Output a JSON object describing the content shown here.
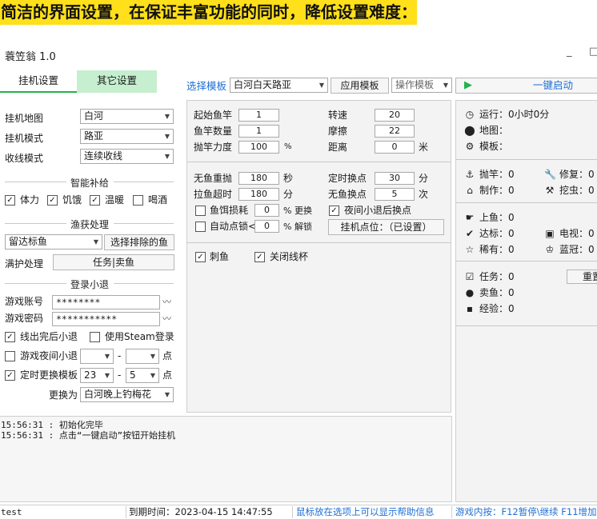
{
  "banner": "简洁的界面设置，在保证丰富功能的同时，降低设置难度：",
  "app": {
    "title": "蓑笠翁 1.0",
    "minimize": "_",
    "maximize": "□"
  },
  "tabs": {
    "t1": "挂机设置",
    "t2": "其它设置"
  },
  "toolbar": {
    "template_label": "选择模板",
    "template_value": "白河白天路亚",
    "apply": "应用模板",
    "ops": "操作模板",
    "play": "▶",
    "start": "一键启动"
  },
  "left": {
    "map_label": "挂机地图",
    "map_value": "白河",
    "mode_label": "挂机模式",
    "mode_value": "路亚",
    "reel_label": "收线模式",
    "reel_value": "连续收线",
    "supply_title": "智能补给",
    "supply": {
      "a": "体力",
      "b": "饥饿",
      "c": "温暖",
      "d": "喝酒"
    },
    "catch_title": "渔获处理",
    "catch_value": "留达标鱼",
    "exclude_btn": "选择排除的鱼",
    "full_label": "满护处理",
    "full_value": "任务|卖鱼",
    "login_title": "登录小退",
    "account_label": "游戏账号",
    "account_value": "********",
    "password_label": "游戏密码",
    "password_value": "***********",
    "logout_after": "线出完后小退",
    "steam_login": "使用Steam登录",
    "night_logout": "游戏夜间小退",
    "dash1": "-",
    "dot1": "点",
    "timed_change": "定时更换模板",
    "hour_from": "23",
    "dash2": "-",
    "hour_to": "5",
    "dot2": "点",
    "change_to_label": "更换为",
    "change_to_value": "白河晚上钓梅花"
  },
  "mid": {
    "start_rod_l": "起始鱼竿",
    "start_rod_v": "1",
    "rod_count_l": "鱼竿数量",
    "rod_count_v": "1",
    "cast_power_l": "抛竿力度",
    "cast_power_v": "100",
    "cast_power_u": "%",
    "speed_l": "转速",
    "speed_v": "20",
    "drag_l": "摩擦",
    "drag_v": "22",
    "dist_l": "距离",
    "dist_v": "0",
    "dist_u": "米",
    "nofish_recast_l": "无鱼重抛",
    "nofish_recast_v": "180",
    "nofish_recast_u": "秒",
    "pull_timeout_l": "拉鱼超时",
    "pull_timeout_v": "180",
    "pull_timeout_u": "分",
    "bait_l": "鱼饵损耗",
    "bait_v": "0",
    "bait_u": "% 更换",
    "auto_l": "自动点锁<",
    "auto_v": "0",
    "auto_u": "% 解锁",
    "timed_spot_l": "定时换点",
    "timed_spot_v": "30",
    "timed_spot_u": "分",
    "nofish_spot_l": "无鱼换点",
    "nofish_spot_v": "5",
    "nofish_spot_u": "次",
    "night_spot": "夜间小退后换点",
    "hang_spot": "挂机点位：（已设置）",
    "stab": "刺鱼",
    "close_cup": "关闭线杯"
  },
  "log": {
    "lines": [
      "15:56:31 : 初始化完毕",
      "15:56:31 : 点击“一键启动”按钮开始挂机"
    ]
  },
  "right": {
    "run": "运行：0小时0分",
    "map": "地图：",
    "tpl": "模板：",
    "cast": "抛竿：0",
    "repair": "修复：0",
    "craft": "制作：0",
    "dig": "挖虫：0",
    "catch": "上鱼：0",
    "qualify": "达标：0",
    "tv": "电视：0",
    "rare": "稀有：0",
    "blue": "蓝冠：0",
    "task": "任务：0",
    "reset": "重置",
    "sell": "卖鱼：0",
    "exp": "经验：0"
  },
  "statusbar": {
    "user": "test",
    "expire": "到期时间：2023-04-15 14:47:55",
    "hint": "鼠标放在选项上可以显示帮助信息",
    "hotkeys": "游戏内按：F12暂停\\继续 F11增加"
  },
  "colors": {
    "banner": "#ffe01a",
    "accent_green": "#21b24b",
    "link_blue": "#1e6fd6",
    "active_tab": "#c6efd0"
  }
}
